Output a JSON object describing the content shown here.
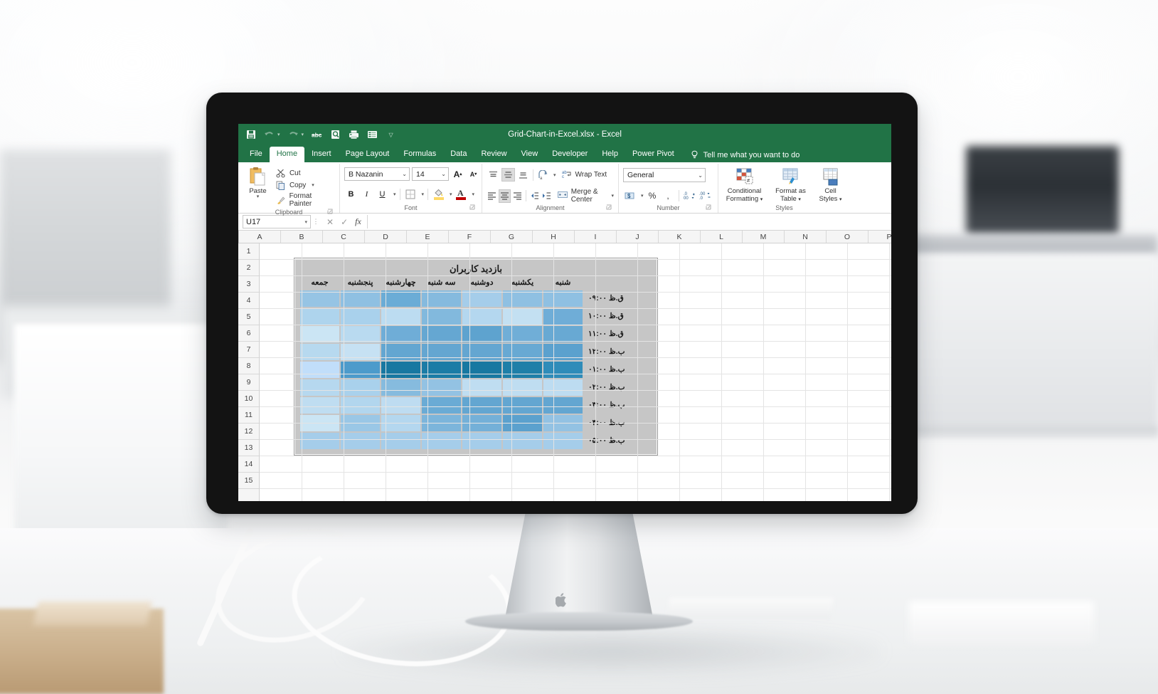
{
  "scene": {
    "device": "apple-thunderbolt-display",
    "logo": "apple-logo"
  },
  "window": {
    "title": "Grid-Chart-in-Excel.xlsx  -  Excel",
    "accent_color": "#217346"
  },
  "quick_access": {
    "items": [
      {
        "name": "save-icon",
        "label": "Save"
      },
      {
        "name": "undo-icon",
        "label": "Undo"
      },
      {
        "name": "redo-icon",
        "label": "Redo"
      },
      {
        "name": "spelling-icon",
        "label": "Spelling"
      },
      {
        "name": "print-preview-icon",
        "label": "Print Preview and Print"
      },
      {
        "name": "print-icon",
        "label": "Quick Print"
      },
      {
        "name": "form-icon",
        "label": "Form"
      },
      {
        "name": "customize-qat-icon",
        "label": "Customize Quick Access Toolbar"
      }
    ]
  },
  "ribbon": {
    "tabs": [
      {
        "label": "File",
        "active": false
      },
      {
        "label": "Home",
        "active": true
      },
      {
        "label": "Insert",
        "active": false
      },
      {
        "label": "Page Layout",
        "active": false
      },
      {
        "label": "Formulas",
        "active": false
      },
      {
        "label": "Data",
        "active": false
      },
      {
        "label": "Review",
        "active": false
      },
      {
        "label": "View",
        "active": false
      },
      {
        "label": "Developer",
        "active": false
      },
      {
        "label": "Help",
        "active": false
      },
      {
        "label": "Power Pivot",
        "active": false
      }
    ],
    "tell_me": "Tell me what you want to do",
    "groups": {
      "clipboard": {
        "label": "Clipboard",
        "paste": "Paste",
        "cut": "Cut",
        "copy": "Copy",
        "format_painter": "Format Painter"
      },
      "font": {
        "label": "Font",
        "font_name": "B Nazanin",
        "font_size": "14",
        "grow_font": "A",
        "shrink_font": "A",
        "bold": "B",
        "italic": "I",
        "underline": "U"
      },
      "alignment": {
        "label": "Alignment",
        "wrap_text": "Wrap Text",
        "merge_center": "Merge & Center"
      },
      "number": {
        "label": "Number",
        "format": "General",
        "percent": "%",
        "comma": ","
      },
      "styles": {
        "label": "Styles",
        "conditional_formatting": "Conditional\nFormatting",
        "conditional_formatting_l1": "Conditional",
        "conditional_formatting_l2": "Formatting",
        "format_as_table_l1": "Format as",
        "format_as_table_l2": "Table",
        "cell_styles_l1": "Cell",
        "cell_styles_l2": "Styles"
      }
    }
  },
  "formula_bar": {
    "name_box": "U17",
    "cancel": "✕",
    "enter": "✓",
    "insert_function": "fx",
    "value": ""
  },
  "sheet": {
    "columns": [
      "A",
      "B",
      "C",
      "D",
      "E",
      "F",
      "G",
      "H",
      "I",
      "J",
      "K",
      "L",
      "M",
      "N",
      "O",
      "P"
    ],
    "rows": [
      "1",
      "2",
      "3",
      "4",
      "5",
      "6",
      "7",
      "8",
      "9",
      "10",
      "11",
      "12",
      "13",
      "14",
      "15"
    ]
  },
  "chart_data": {
    "type": "heatmap",
    "title": "بازدید کاربران",
    "xlabel": "",
    "ylabel": "",
    "direction": "rtl",
    "categories": [
      "شنبه",
      "یکشنبه",
      "دوشنبه",
      "سه شنبه",
      "چهارشنبه",
      "پنجشنبه",
      "جمعه"
    ],
    "row_labels": [
      "ق.ظ ۰۹:۰۰",
      "ق.ظ ۱۰:۰۰",
      "ق.ظ ۱۱:۰۰",
      "ب.ظ ۱۲:۰۰",
      "ب.ظ ۰۱:۰۰",
      "ب.ظ ۰۲:۰۰",
      "ب.ظ ۰۳:۰۰",
      "ب.ظ ۰۴:۰۰",
      "ب.ظ ۰۵:۰۰"
    ],
    "colorscale": {
      "low": "#cfe5f3",
      "mid": "#7fb6dc",
      "high": "#1f7fa8"
    },
    "legend": "none",
    "grid": true,
    "values": [
      [
        4,
        4,
        3,
        5,
        6,
        4,
        4
      ],
      [
        6,
        2,
        3,
        5,
        2,
        3,
        3
      ],
      [
        6,
        6,
        7,
        6,
        6,
        3,
        2
      ],
      [
        7,
        6,
        6,
        6,
        6,
        2,
        3
      ],
      [
        8,
        9,
        9,
        9,
        9,
        6,
        3
      ],
      [
        2,
        2,
        2,
        4,
        5,
        4,
        3
      ],
      [
        6,
        6,
        6,
        6,
        2,
        3,
        3
      ],
      [
        4,
        6,
        5,
        5,
        3,
        4,
        2
      ],
      [
        3,
        3,
        3,
        3,
        3,
        3,
        3
      ]
    ],
    "cell_colors": [
      [
        "#8fc0e2",
        "#8fc0e2",
        "#a5cdea",
        "#85bade",
        "#6bacd6",
        "#8fc0e2",
        "#96c4e4"
      ],
      [
        "#6fadd7",
        "#c3e0f2",
        "#b4d7ef",
        "#82b9dd",
        "#bcdcf1",
        "#a9d1ec",
        "#aed4ed"
      ],
      [
        "#68a9d3",
        "#70aed7",
        "#5ea3cf",
        "#65a7d2",
        "#6fadd7",
        "#b9daf0",
        "#cbe5f4"
      ],
      [
        "#5ba1ce",
        "#68a9d3",
        "#64a6d1",
        "#64a6d1",
        "#63a6d1",
        "#c6e1f3",
        "#b7d9ef"
      ],
      [
        "#2f8cb9",
        "#1f7fa8",
        "#1878a1",
        "#1b7ca6",
        "#1878a1",
        "#4d9bcb",
        "#c1defa"
      ],
      [
        "#bddcf1",
        "#bfddf1",
        "#bfddf1",
        "#93c2e3",
        "#86bbde",
        "#a9d1ec",
        "#b6d8ef"
      ],
      [
        "#63a6d1",
        "#63a6d1",
        "#63a6d1",
        "#6aabd5",
        "#bedcf1",
        "#b2d6ee",
        "#bfddf1"
      ],
      [
        "#93c2e3",
        "#5ba1ce",
        "#74b0d8",
        "#7cb5db",
        "#b4d7ef",
        "#9ac7e6",
        "#cbe5f4"
      ],
      [
        "#a5cdea",
        "#a5cdea",
        "#a5cdea",
        "#a5cdea",
        "#a5cdea",
        "#a5cdea",
        "#a5cdea"
      ]
    ]
  }
}
